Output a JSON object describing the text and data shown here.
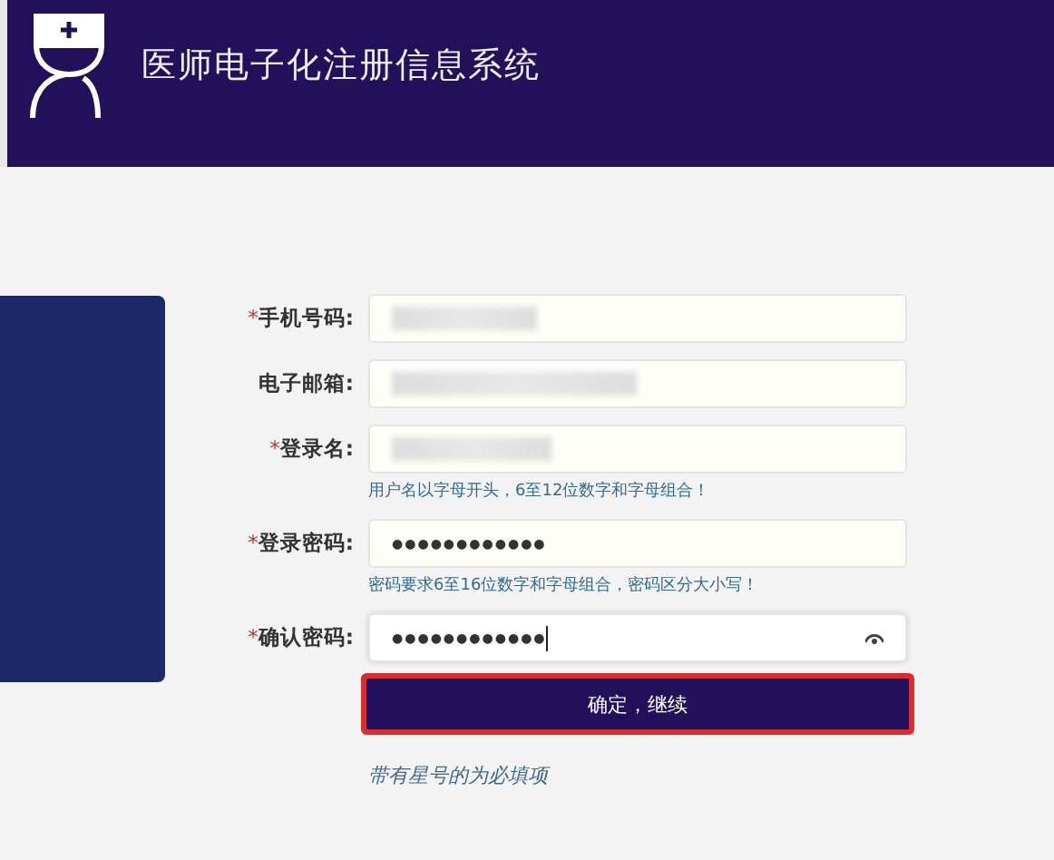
{
  "header": {
    "title": "医师电子化注册信息系统"
  },
  "fields": [
    {
      "mark": "*",
      "label": "手机号码:",
      "kind": "text",
      "blurred": true,
      "focused": false
    },
    {
      "label": "电子邮箱:",
      "kind": "text",
      "blurred": true,
      "focused": false
    },
    {
      "mark": "*",
      "label": "登录名:",
      "kind": "text",
      "blurred": true,
      "focused": false,
      "hint": "用户名以字母开头，6至12位数字和字母组合！"
    },
    {
      "mark": "*",
      "label": "登录密码:",
      "kind": "password",
      "value": "●●●●●●●●●●●●",
      "focused": false,
      "hint": "密码要求6至16位数字和字母组合，密码区分大小写！"
    },
    {
      "mark": "*",
      "label": "确认密码:",
      "kind": "password",
      "value": "●●●●●●●●●●●●",
      "focused": true,
      "reveal_icon": true
    }
  ],
  "submit": {
    "label": "确定，继续"
  },
  "note": "带有星号的为必填项"
}
